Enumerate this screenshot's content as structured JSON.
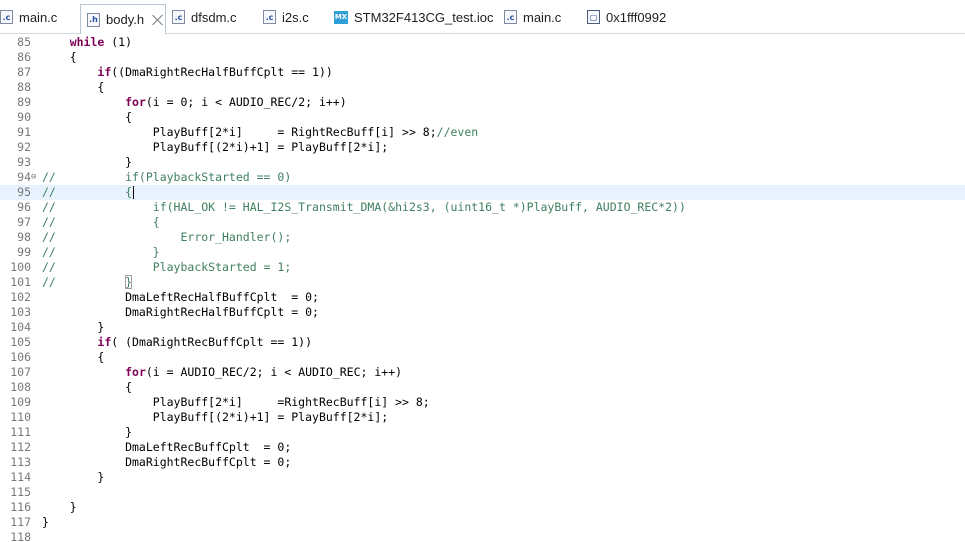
{
  "tabs": [
    {
      "label": "main.c",
      "icon": "c-file-icon",
      "active": false
    },
    {
      "label": "body.h",
      "icon": "h-file-icon",
      "active": true
    },
    {
      "label": "dfsdm.c",
      "icon": "c-file-icon",
      "active": false
    },
    {
      "label": "i2s.c",
      "icon": "c-file-icon",
      "active": false
    },
    {
      "label": "STM32F413CG_test.ioc",
      "icon": "mx-file-icon",
      "active": false
    },
    {
      "label": "main.c",
      "icon": "c-file-icon",
      "active": false
    },
    {
      "label": "0x1fff0992",
      "icon": "disassembly-icon",
      "active": false
    }
  ],
  "colors": {
    "keyword": "#7f0055",
    "comment": "#3f7f5f",
    "line_number": "#787878",
    "current_line": "#e8f2fe"
  },
  "editor": {
    "current_line": "95",
    "lines": [
      {
        "no": "85",
        "prefix": "",
        "segs": [
          {
            "t": "    "
          },
          {
            "t": "while",
            "c": "kw"
          },
          {
            "t": " (1)"
          }
        ]
      },
      {
        "no": "86",
        "prefix": "",
        "segs": [
          {
            "t": "    {"
          }
        ]
      },
      {
        "no": "87",
        "prefix": "",
        "segs": [
          {
            "t": "        "
          },
          {
            "t": "if",
            "c": "kw"
          },
          {
            "t": "((DmaRightRecHalfBuffCplt == 1))"
          }
        ]
      },
      {
        "no": "88",
        "prefix": "",
        "segs": [
          {
            "t": "        {"
          }
        ]
      },
      {
        "no": "89",
        "prefix": "",
        "segs": [
          {
            "t": "            "
          },
          {
            "t": "for",
            "c": "kw"
          },
          {
            "t": "(i = 0; i < AUDIO_REC/2; i++)"
          }
        ]
      },
      {
        "no": "90",
        "prefix": "",
        "segs": [
          {
            "t": "            {"
          }
        ]
      },
      {
        "no": "91",
        "prefix": "",
        "segs": [
          {
            "t": "                PlayBuff[2*i]     = RightRecBuff[i] >> 8;"
          },
          {
            "t": "//even",
            "c": "cm"
          }
        ]
      },
      {
        "no": "92",
        "prefix": "",
        "segs": [
          {
            "t": "                PlayBuff[(2*i)+1] = PlayBuff[2*i];"
          }
        ]
      },
      {
        "no": "93",
        "prefix": "",
        "segs": [
          {
            "t": "            }"
          }
        ]
      },
      {
        "no": "94",
        "prefix": "",
        "fold": "⊖",
        "segs": [
          {
            "t": "//          if(PlaybackStarted == 0)",
            "c": "cm"
          }
        ]
      },
      {
        "no": "95",
        "prefix": "",
        "caret": true,
        "segs": [
          {
            "t": "//          {",
            "c": "cm"
          }
        ]
      },
      {
        "no": "96",
        "prefix": "",
        "segs": [
          {
            "t": "//              if(HAL_OK != HAL_I2S_Transmit_DMA(&hi2s3, (uint16_t *)PlayBuff, AUDIO_REC*2))",
            "c": "cm"
          }
        ]
      },
      {
        "no": "97",
        "prefix": "",
        "segs": [
          {
            "t": "//              {",
            "c": "cm"
          }
        ]
      },
      {
        "no": "98",
        "prefix": "",
        "segs": [
          {
            "t": "//                  Error_Handler();",
            "c": "cm"
          }
        ]
      },
      {
        "no": "99",
        "prefix": "",
        "segs": [
          {
            "t": "//              }",
            "c": "cm"
          }
        ]
      },
      {
        "no": "100",
        "prefix": "",
        "segs": [
          {
            "t": "//              PlaybackStarted = 1;",
            "c": "cm"
          }
        ]
      },
      {
        "no": "101",
        "prefix": "",
        "brace": true,
        "segs": [
          {
            "t": "//          ",
            "c": "cm"
          },
          {
            "t": "}",
            "c": "cm",
            "box": true
          }
        ]
      },
      {
        "no": "102",
        "prefix": "",
        "segs": [
          {
            "t": "            DmaLeftRecHalfBuffCplt  = 0;"
          }
        ]
      },
      {
        "no": "103",
        "prefix": "",
        "segs": [
          {
            "t": "            DmaRightRecHalfBuffCplt = 0;"
          }
        ]
      },
      {
        "no": "104",
        "prefix": "",
        "segs": [
          {
            "t": "        }"
          }
        ]
      },
      {
        "no": "105",
        "prefix": "",
        "segs": [
          {
            "t": "        "
          },
          {
            "t": "if",
            "c": "kw"
          },
          {
            "t": "( (DmaRightRecBuffCplt == 1))"
          }
        ]
      },
      {
        "no": "106",
        "prefix": "",
        "segs": [
          {
            "t": "        {"
          }
        ]
      },
      {
        "no": "107",
        "prefix": "",
        "segs": [
          {
            "t": "            "
          },
          {
            "t": "for",
            "c": "kw"
          },
          {
            "t": "(i = AUDIO_REC/2; i < AUDIO_REC; i++)"
          }
        ]
      },
      {
        "no": "108",
        "prefix": "",
        "segs": [
          {
            "t": "            {"
          }
        ]
      },
      {
        "no": "109",
        "prefix": "",
        "segs": [
          {
            "t": "                PlayBuff[2*i]     =RightRecBuff[i] >> 8;"
          }
        ]
      },
      {
        "no": "110",
        "prefix": "",
        "segs": [
          {
            "t": "                PlayBuff[(2*i)+1] = PlayBuff[2*i];"
          }
        ]
      },
      {
        "no": "111",
        "prefix": "",
        "segs": [
          {
            "t": "            }"
          }
        ]
      },
      {
        "no": "112",
        "prefix": "",
        "segs": [
          {
            "t": "            DmaLeftRecBuffCplt  = 0;"
          }
        ]
      },
      {
        "no": "113",
        "prefix": "",
        "segs": [
          {
            "t": "            DmaRightRecBuffCplt = 0;"
          }
        ]
      },
      {
        "no": "114",
        "prefix": "",
        "segs": [
          {
            "t": "        }"
          }
        ]
      },
      {
        "no": "115",
        "prefix": "",
        "segs": [
          {
            "t": ""
          }
        ]
      },
      {
        "no": "116",
        "prefix": "",
        "segs": [
          {
            "t": "    }"
          }
        ]
      },
      {
        "no": "117",
        "prefix": "",
        "segs": [
          {
            "t": "}"
          }
        ]
      },
      {
        "no": "118",
        "prefix": "",
        "segs": [
          {
            "t": ""
          }
        ]
      }
    ]
  }
}
